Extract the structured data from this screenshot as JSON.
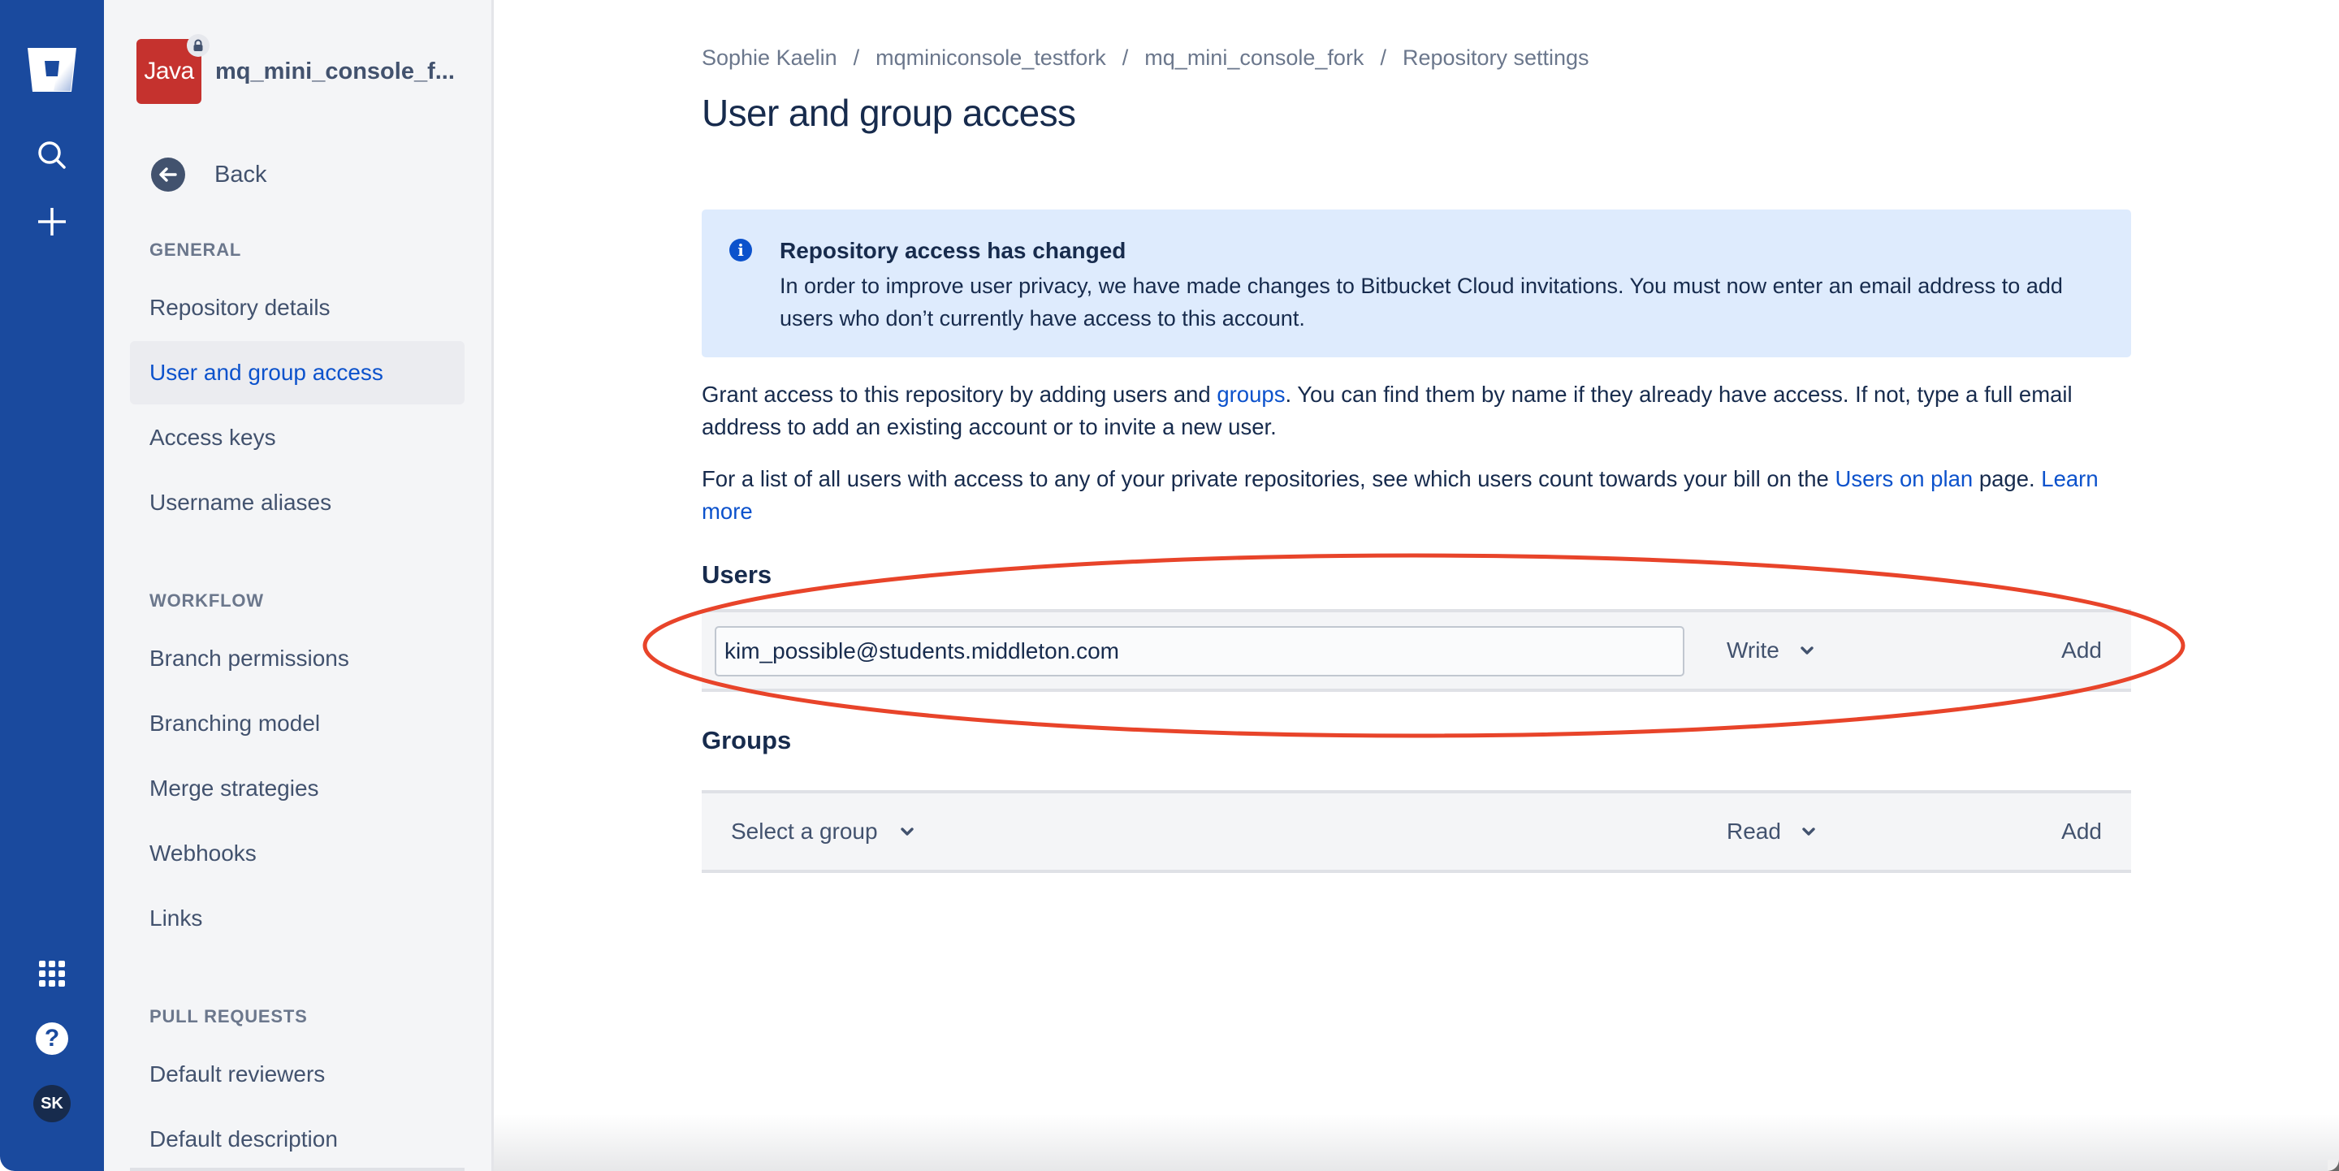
{
  "global_nav": {
    "icons": [
      "bitbucket-logo-icon",
      "search-icon",
      "create-plus-icon",
      "app-switcher-icon",
      "help-icon"
    ],
    "profile_initials": "SK",
    "help_glyph": "?"
  },
  "sidebar": {
    "repo": {
      "avatar_label": "Java",
      "avatar_color": "#c5322e",
      "name": "mq_mini_console_f...",
      "private": true
    },
    "back_label": "Back",
    "sections": [
      {
        "heading": "GENERAL",
        "items": [
          {
            "label": "Repository details",
            "active": false
          },
          {
            "label": "User and group access",
            "active": true
          },
          {
            "label": "Access keys",
            "active": false
          },
          {
            "label": "Username aliases",
            "active": false
          }
        ]
      },
      {
        "heading": "WORKFLOW",
        "items": [
          {
            "label": "Branch permissions",
            "active": false
          },
          {
            "label": "Branching model",
            "active": false
          },
          {
            "label": "Merge strategies",
            "active": false
          },
          {
            "label": "Webhooks",
            "active": false
          },
          {
            "label": "Links",
            "active": false
          }
        ]
      },
      {
        "heading": "PULL REQUESTS",
        "items": [
          {
            "label": "Default reviewers",
            "active": false
          },
          {
            "label": "Default description",
            "active": false
          }
        ]
      }
    ]
  },
  "breadcrumb": {
    "items": [
      "Sophie Kaelin",
      "mqminiconsole_testfork",
      "mq_mini_console_fork",
      "Repository settings"
    ],
    "separator": "/"
  },
  "page_title": "User and group access",
  "banner": {
    "title": "Repository access has changed",
    "body": "In order to improve user privacy, we have made changes to Bitbucket Cloud invitations. You must now enter an email address to add users who don’t currently have access to this account.",
    "icon_glyph": "i"
  },
  "intro": {
    "p1_before": "Grant access to this repository by adding users and ",
    "p1_link": "groups",
    "p1_after": ". You can find them by name if they already have access. If not, type a full email address to add an existing account or to invite a new user.",
    "p2_before": "For a list of all users with access to any of your private repositories, see which users count towards your bill on the ",
    "p2_link": "Users on plan",
    "p2_after": " page. ",
    "p2_learn_more": "Learn more"
  },
  "users": {
    "heading": "Users",
    "input_value": "kim_possible@students.middleton.com",
    "permission": "Write",
    "add_label": "Add"
  },
  "groups": {
    "heading": "Groups",
    "select_placeholder": "Select a group",
    "permission": "Read",
    "add_label": "Add"
  },
  "annotation": {
    "shape": "ellipse",
    "color": "#e8442a",
    "highlights": "users-row"
  },
  "colors": {
    "global_nav": "#1a4a9e",
    "sidebar_bg": "#f4f5f7",
    "link": "#0c52cc",
    "banner_bg": "#deebfd",
    "text": "#172b4d",
    "muted_text": "#42526e"
  }
}
